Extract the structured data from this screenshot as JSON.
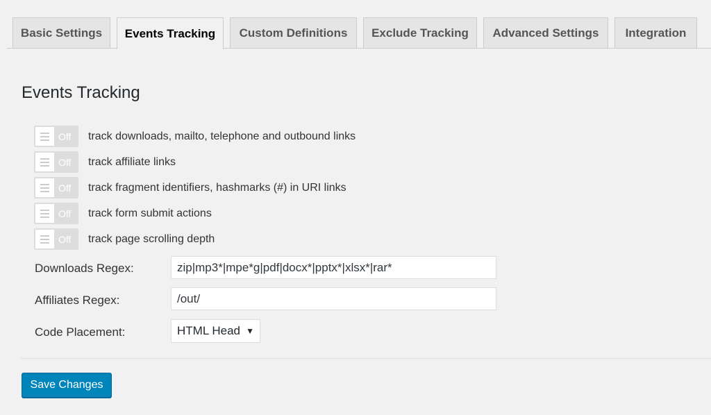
{
  "tabs": [
    {
      "label": "Basic Settings"
    },
    {
      "label": "Events Tracking",
      "active": true
    },
    {
      "label": "Custom Definitions"
    },
    {
      "label": "Exclude Tracking"
    },
    {
      "label": "Advanced Settings"
    },
    {
      "label": "Integration"
    }
  ],
  "section_title": "Events Tracking",
  "toggles": [
    {
      "state": "Off",
      "label": "track downloads, mailto, telephone and outbound links"
    },
    {
      "state": "Off",
      "label": "track affiliate links"
    },
    {
      "state": "Off",
      "label": "track fragment identifiers, hashmarks (#) in URI links"
    },
    {
      "state": "Off",
      "label": "track form submit actions"
    },
    {
      "state": "Off",
      "label": "track page scrolling depth"
    }
  ],
  "fields": {
    "downloads": {
      "label": "Downloads Regex:",
      "value": "zip|mp3*|mpe*g|pdf|docx*|pptx*|xlsx*|rar*"
    },
    "affiliates": {
      "label": "Affiliates Regex:",
      "value": "/out/"
    },
    "placement": {
      "label": "Code Placement:",
      "value": "HTML Head"
    }
  },
  "save_label": "Save Changes",
  "colors": {
    "primary": "#0085ba",
    "background": "#f1f1f1"
  }
}
